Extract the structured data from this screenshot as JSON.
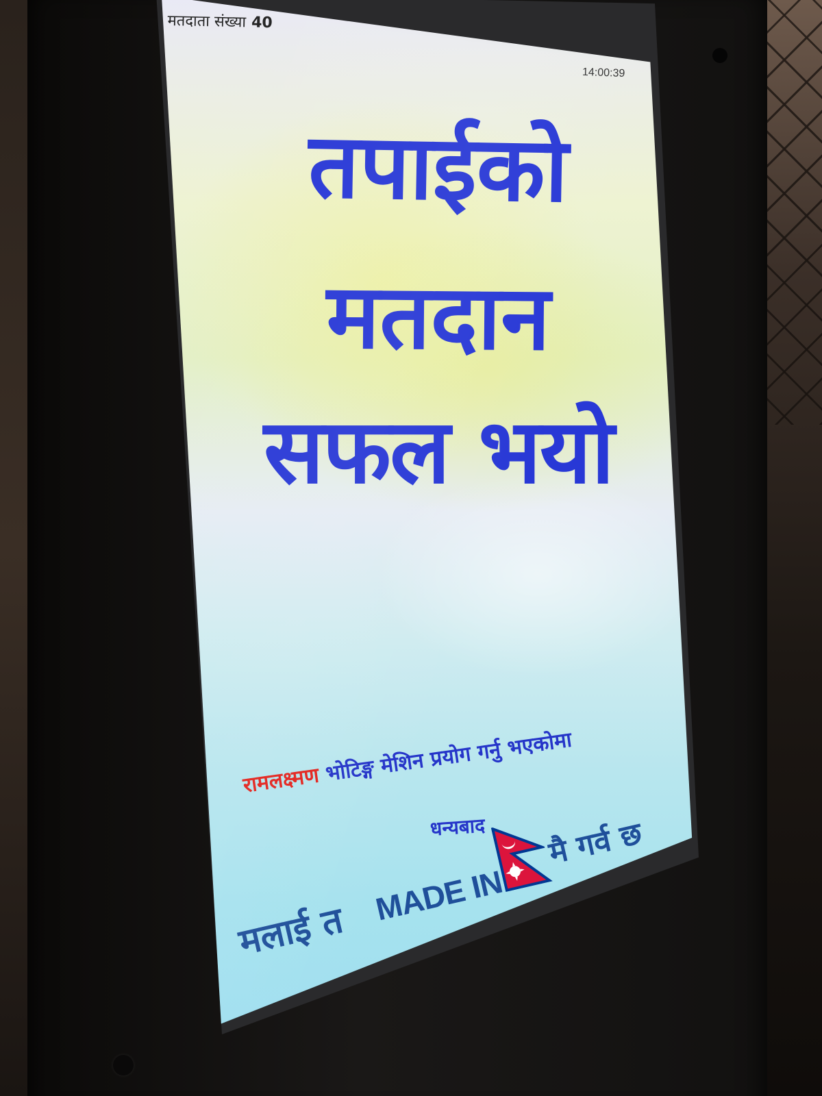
{
  "status_bar": {
    "voter_count_label": "मतदाता संख्या",
    "voter_count_value": "40",
    "time": "14:00:39"
  },
  "message": {
    "line1": "तपाईको",
    "line2": "मतदान",
    "line3": "सफल भयो"
  },
  "footer": {
    "brand": "रामलक्ष्मण",
    "machine_text": "भोटिङ्ग मेशिन प्रयोग गर्नु भएकोमा",
    "thanks": "धन्यबाद"
  },
  "slogan": {
    "prefix": "मलाई त",
    "made_in": "MADE IN",
    "suffix": "मै गर्व छ",
    "flag_icon": "nepal-flag-icon"
  },
  "colors": {
    "headline": "#2838d6",
    "brand_red": "#e3231d",
    "footer_blue": "#2535c9",
    "slogan_blue": "#1f4f9a",
    "flag_red": "#dc143c",
    "flag_blue": "#003893"
  }
}
